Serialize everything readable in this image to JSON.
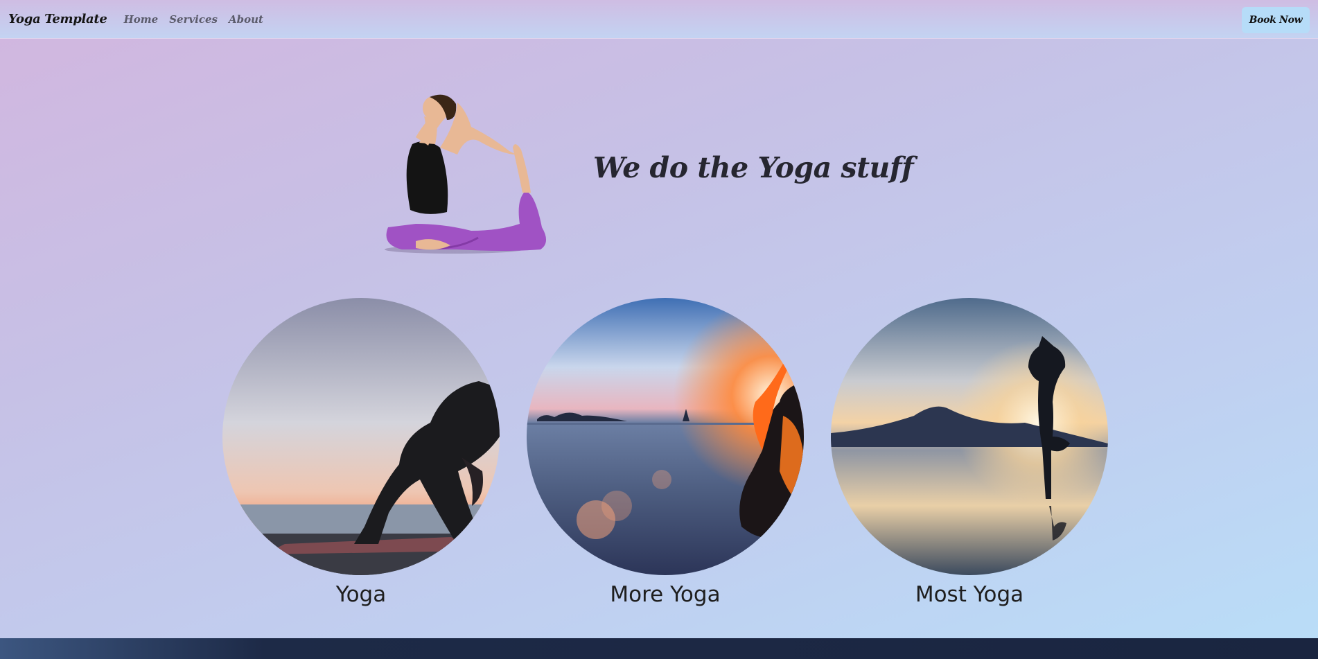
{
  "nav": {
    "brand": "Yoga Template",
    "links": [
      {
        "label": "Home"
      },
      {
        "label": "Services"
      },
      {
        "label": "About"
      }
    ],
    "book_label": "Book Now"
  },
  "hero": {
    "title": "We do the Yoga stuff"
  },
  "cards": [
    {
      "caption": "Yoga"
    },
    {
      "caption": "More Yoga"
    },
    {
      "caption": "Most Yoga"
    }
  ],
  "colors": {
    "accent_button": "#b6dcf8",
    "footer": "#1d2a47",
    "leggings": "#a052c4"
  }
}
